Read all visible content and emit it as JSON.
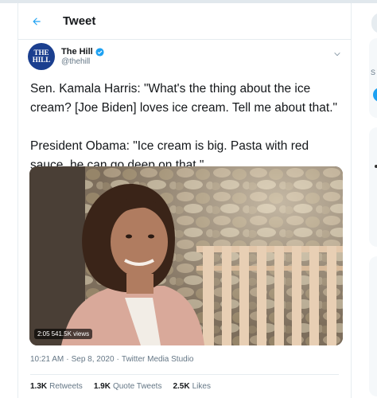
{
  "header": {
    "title": "Tweet"
  },
  "author": {
    "avatar_text": [
      "THE",
      "HILL"
    ],
    "display_name": "The Hill",
    "handle": "@thehill"
  },
  "tweet": {
    "paragraphs": [
      "Sen. Kamala Harris: \"What's the thing about the ice cream? [Joe Biden] loves ice cream. Tell me about that.\"",
      "President Obama: \"Ice cream is big. Pasta with red sauce, he can go deep on that.\""
    ]
  },
  "media": {
    "duration": "2:05",
    "views": "541.5K views"
  },
  "meta": {
    "time": "10:21 AM",
    "separator": "·",
    "date": "Sep 8, 2020",
    "separator2": "·",
    "source": "Twitter Media Studio"
  },
  "stats": {
    "retweets_count": "1.3K",
    "retweets_label": "Retweets",
    "quotes_count": "1.9K",
    "quotes_label": "Quote Tweets",
    "likes_count": "2.5K",
    "likes_label": "Likes"
  },
  "right_sidebar": {
    "clipped_letter": "S"
  },
  "colors": {
    "accent": "#1da1f2",
    "avatar_bg": "#1b3f8f",
    "secondary_text": "#657786"
  },
  "icons": {
    "back": "arrow-left-icon",
    "verified": "verified-badge-icon",
    "more": "chevron-down-icon"
  }
}
